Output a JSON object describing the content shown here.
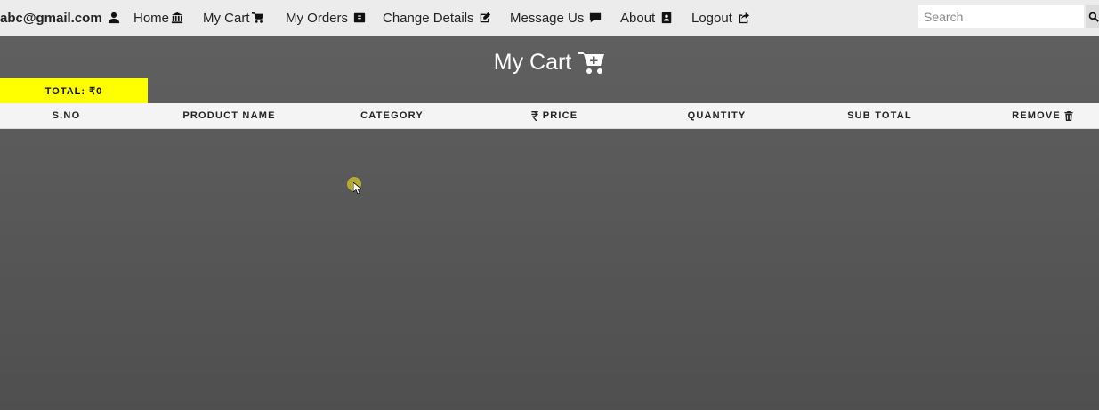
{
  "nav": {
    "user_email": "abc@gmail.com",
    "items": [
      {
        "label": "Home",
        "icon": "bank-icon"
      },
      {
        "label": "My Cart",
        "icon": "cart-icon"
      },
      {
        "label": "My Orders",
        "icon": "orders-icon"
      },
      {
        "label": "Change Details",
        "icon": "edit-icon"
      },
      {
        "label": "Message Us",
        "icon": "comment-icon"
      },
      {
        "label": "About",
        "icon": "address-book-icon"
      },
      {
        "label": "Logout",
        "icon": "share-icon"
      }
    ],
    "search_placeholder": "Search"
  },
  "page": {
    "title": "My Cart",
    "total_label": "TOTAL: ₹0"
  },
  "table": {
    "columns": [
      "S.NO",
      "PRODUCT NAME",
      "CATEGORY",
      "PRICE",
      "QUANTITY",
      "SUB TOTAL",
      "REMOVE"
    ],
    "rows": []
  },
  "colors": {
    "background": "#5a5a5a",
    "nav_bg": "#ececec",
    "total_badge": "#ffff00",
    "header_bg": "#f4f4f4"
  }
}
